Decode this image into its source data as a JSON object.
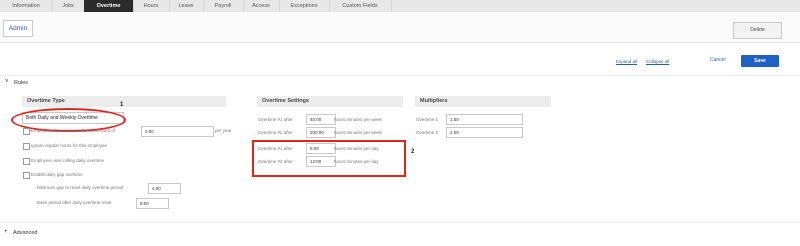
{
  "tabs": [
    {
      "label": "Information",
      "active": false
    },
    {
      "label": "Jobs",
      "active": false
    },
    {
      "label": "Overtime",
      "active": true
    },
    {
      "label": "Hours",
      "active": false
    },
    {
      "label": "Leave",
      "active": false
    },
    {
      "label": "Payroll",
      "active": false
    },
    {
      "label": "Access",
      "active": false
    },
    {
      "label": "Exceptions",
      "active": false
    },
    {
      "label": "Custom Fields",
      "active": false
    }
  ],
  "header": {
    "title": "Admin",
    "delete_label": "Delete"
  },
  "toolbar": {
    "expand_all": "Expand all",
    "collapse_all": "Collapse all",
    "cancel": "Cancel",
    "save": "Save"
  },
  "rules_section": {
    "title": "Rules",
    "toggle": "˅"
  },
  "overtime_type": {
    "heading": "Overtime Type",
    "selected": "Both Daily and Weekly Overtime",
    "annotation": "1",
    "options": [
      {
        "label": "Employee also earns a salaried amount of",
        "value": "0.00",
        "suffix": "per year"
      },
      {
        "label": "Ignore regular hours for this employee"
      },
      {
        "label": "Employee uses rolling daily overtime"
      },
      {
        "label": "Enable daily gap overtime"
      }
    ],
    "gap_fields": [
      {
        "label": "Minimum gap to reset daily overtime period",
        "value": "4:00"
      },
      {
        "label": "Base period after daily overtime reset",
        "value": "8:00"
      }
    ]
  },
  "overtime_settings": {
    "heading": "Overtime Settings",
    "rows": [
      {
        "label": "Overtime #1 after",
        "value": "40:00",
        "unit": "hours:minutes per week"
      },
      {
        "label": "Overtime #2 after",
        "value": "200:00",
        "unit": "hours:minutes per week"
      },
      {
        "label": "Overtime #1 after",
        "value": "8:00",
        "unit": "hours:minutes per day"
      },
      {
        "label": "Overtime #2 after",
        "value": "12:00",
        "unit": "hours:minutes per day"
      }
    ],
    "annotation": "2"
  },
  "multipliers": {
    "heading": "Multipliers",
    "rows": [
      {
        "label": "Overtime 1",
        "value": "1.50"
      },
      {
        "label": "Overtime 2",
        "value": "2.00"
      }
    ]
  },
  "advanced_section": {
    "title": "Advanced",
    "toggle": "+"
  },
  "colors": {
    "accent": "#1e62c6",
    "annotation": "#e0261c",
    "tab_active": "#2b2b2b"
  }
}
